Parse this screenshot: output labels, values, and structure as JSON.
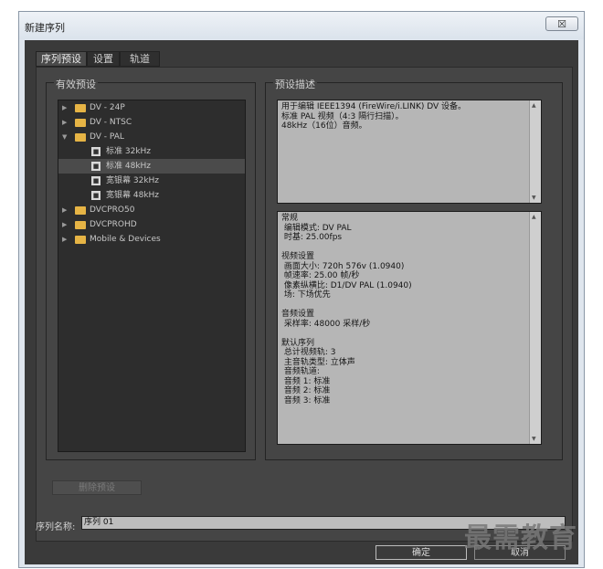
{
  "window": {
    "title": "新建序列",
    "close_glyph": "☒"
  },
  "tabs": [
    {
      "label": "序列预设",
      "active": true
    },
    {
      "label": "设置",
      "active": false
    },
    {
      "label": "轨道",
      "active": false
    }
  ],
  "presets_group": {
    "label": "有效预设",
    "items": [
      {
        "label": "DV - 24P",
        "type": "folder",
        "expanded": false
      },
      {
        "label": "DV - NTSC",
        "type": "folder",
        "expanded": false
      },
      {
        "label": "DV - PAL",
        "type": "folder",
        "expanded": true
      },
      {
        "label": "标准 32kHz",
        "type": "preset"
      },
      {
        "label": "标准 48kHz",
        "type": "preset",
        "selected": true
      },
      {
        "label": "宽银幕 32kHz",
        "type": "preset"
      },
      {
        "label": "宽银幕 48kHz",
        "type": "preset"
      },
      {
        "label": "DVCPRO50",
        "type": "folder",
        "expanded": false
      },
      {
        "label": "DVCPROHD",
        "type": "folder",
        "expanded": false
      },
      {
        "label": "Mobile & Devices",
        "type": "folder",
        "expanded": false
      }
    ]
  },
  "description_group": {
    "label": "预设描述",
    "summary": "用于编辑 IEEE1394 (FireWire/i.LINK) DV 设备。\n标准 PAL 视频（4:3 隔行扫描）。\n48kHz（16位）音频。",
    "details": "常规\n 编辑模式: DV PAL\n 时基: 25.00fps\n\n视频设置\n 画面大小: 720h 576v (1.0940)\n 帧速率: 25.00 帧/秒\n 像素纵横比: D1/DV PAL (1.0940)\n 场: 下场优先\n\n音频设置\n 采样率: 48000 采样/秒\n\n默认序列\n 总计视频轨: 3\n 主音轨类型: 立体声\n 音频轨道:\n 音频 1: 标准\n 音频 2: 标准\n 音频 3: 标准"
  },
  "buttons": {
    "delete": "删除预设",
    "ok": "确定",
    "cancel": "取消"
  },
  "sequence_name": {
    "label": "序列名称:",
    "value": "序列 01"
  },
  "watermark": "最需教育",
  "colors": {
    "dialog_bg": "#3a3a3a",
    "panel_bg": "#454545",
    "folder": "#e6b445",
    "text_area": "#b6b6b6"
  }
}
